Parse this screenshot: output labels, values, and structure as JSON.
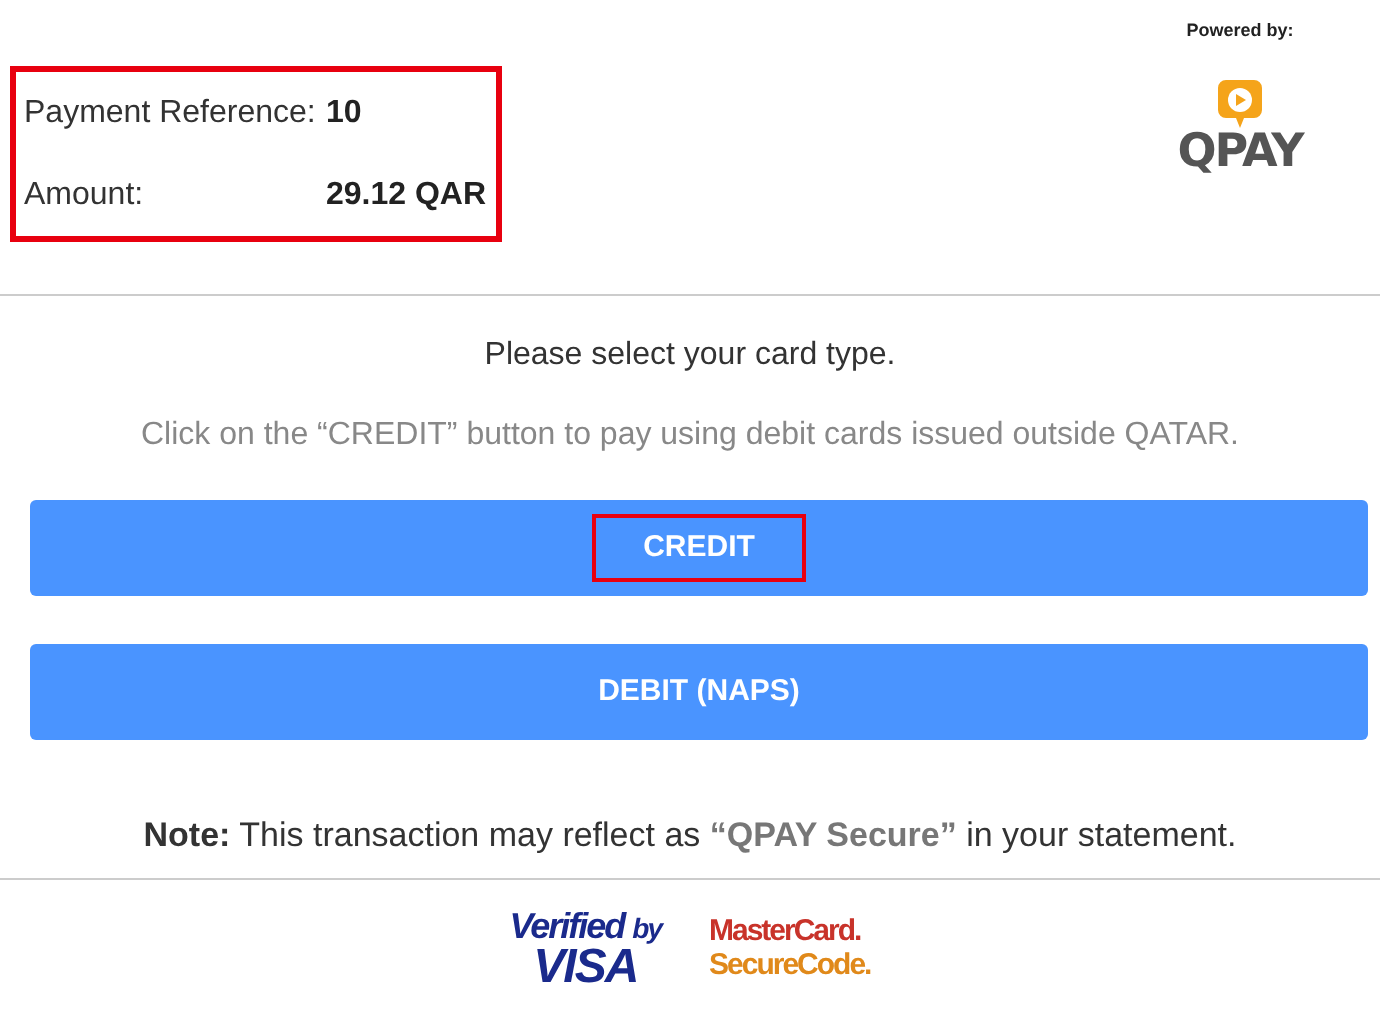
{
  "summary": {
    "highlighted": true,
    "rows": [
      {
        "label": "Payment Reference:",
        "value": "10"
      },
      {
        "label": "Amount:",
        "value": "29.12 QAR"
      }
    ]
  },
  "powered_by": {
    "label": "Powered by:",
    "logo_text": "QPAY"
  },
  "prompt": "Please select your card type.",
  "hint": "Click on the “CREDIT” button to pay using debit cards issued outside QATAR.",
  "buttons": [
    {
      "label": "CREDIT",
      "highlighted": true
    },
    {
      "label": "DEBIT (NAPS)",
      "highlighted": false
    }
  ],
  "note": "**Note:** This transaction may reflect as **“QPAY Secure”** in your statement.",
  "badges": [
    {
      "kind": "visa",
      "line_1": "Verified",
      "line_1b": "by",
      "line_2": "VISA"
    },
    {
      "kind": "mastercard",
      "line_1": "MasterCard.",
      "line_2": "SecureCode."
    }
  ]
}
